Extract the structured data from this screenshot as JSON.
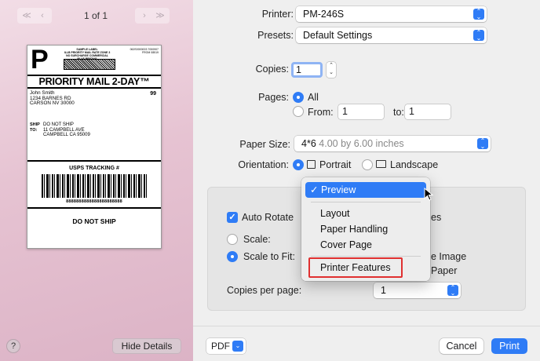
{
  "preview": {
    "prev_icons": "≪ ‹",
    "next_icons": "› ≫",
    "page_count": "1 of 1",
    "label": {
      "big_letter": "P",
      "sample_label": "SAMPLE LABEL",
      "sample_lines": "ILLB PRIORITY MAIL RATE ZONE 3 NO SURCHARGE COMMERCIAL PLUS PRICING",
      "sample_right": "062S0000003 7000907 FROM 08519",
      "mail_class": "PRIORITY MAIL 2-DAY™",
      "from_name": "John Smith",
      "from_addr1": "1234 BARNES RD",
      "from_addr2": "CARSON NV 30000",
      "zone_number": "99",
      "ship_to_tag": "SHIP TO:",
      "to_line1": "DO NOT SHIP",
      "to_line2": "11 CAMPBELL AVE",
      "to_line3": "CAMPBELL CA 95009",
      "tracking_title": "USPS TRACKING #",
      "tracking_number": "8888888888888888888888",
      "footer": "DO NOT SHIP"
    },
    "help_label": "?",
    "hide_details_label": "Hide Details"
  },
  "settings": {
    "printer_label": "Printer:",
    "printer_value": "PM-246S",
    "presets_label": "Presets:",
    "presets_value": "Default Settings",
    "copies_label": "Copies:",
    "copies_value": "1",
    "pages_label": "Pages:",
    "pages_all": "All",
    "pages_from_label": "From:",
    "pages_from_value": "1",
    "pages_to_label": "to:",
    "pages_to_value": "1",
    "paper_size_label": "Paper Size:",
    "paper_size_value": "4*6",
    "paper_size_detail": "4.00 by 6.00 inches",
    "orientation_label": "Orientation:",
    "portrait_label": "Portrait",
    "landscape_label": "Landscape"
  },
  "panel": {
    "auto_rotate_label": "Auto Rotate",
    "auto_rotate_tail": "es",
    "scale_label": "Scale:",
    "scale_to_fit_label": "Scale to Fit:",
    "image_tail": "e Image",
    "paper_tail": "Paper",
    "copies_per_page_label": "Copies per page:",
    "copies_per_page_value": "1"
  },
  "menu": {
    "items": [
      {
        "label": "✓ Preview"
      },
      {
        "label": "Layout"
      },
      {
        "label": "Paper Handling"
      },
      {
        "label": "Cover Page"
      },
      {
        "label": "Printer Features"
      }
    ]
  },
  "footer": {
    "pdf_label": "PDF",
    "cancel_label": "Cancel",
    "print_label": "Print"
  },
  "colors": {
    "accent": "#2f7cf6",
    "highlight": "#e03030"
  }
}
